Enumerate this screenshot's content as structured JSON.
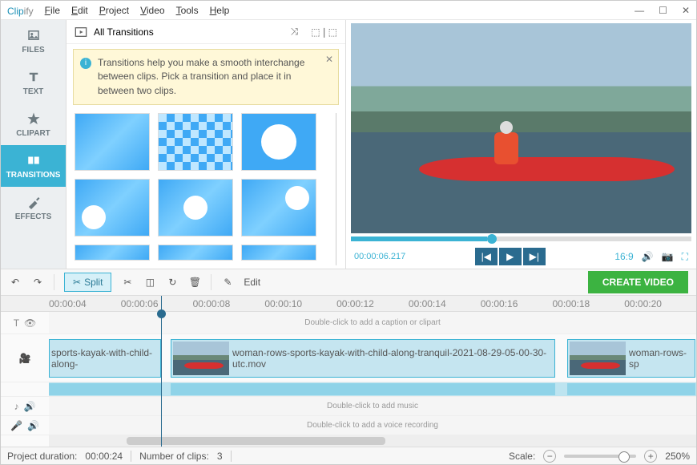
{
  "app": {
    "logo_main": "Clip",
    "logo_suffix": "ify"
  },
  "menu": {
    "file": "File",
    "edit": "Edit",
    "project": "Project",
    "video": "Video",
    "tools": "Tools",
    "help": "Help"
  },
  "sidebar": {
    "files": "FILES",
    "text": "TEXT",
    "clipart": "CLIPART",
    "transitions": "TRANSITIONS",
    "effects": "EFFECTS"
  },
  "center": {
    "title": "All Transitions",
    "info": "Transitions help you make a smooth interchange between clips. Pick a transition and place it in between two clips."
  },
  "preview": {
    "timecode": "00:00:06.217",
    "aspect": "16:9"
  },
  "toolbar": {
    "split": "Split",
    "edit": "Edit",
    "create": "CREATE VIDEO"
  },
  "ruler": {
    "t0": "00:00:04",
    "t1": "00:00:06",
    "t2": "00:00:08",
    "t3": "00:00:10",
    "t4": "00:00:12",
    "t5": "00:00:14",
    "t6": "00:00:16",
    "t7": "00:00:18",
    "t8": "00:00:20"
  },
  "tracks": {
    "caption": "Double-click to add a caption or clipart",
    "music": "Double-click to add music",
    "voice": "Double-click to add a voice recording",
    "clip1": "sports-kayak-with-child-along-",
    "clip2": "woman-rows-sports-kayak-with-child-along-tranquil-2021-08-29-05-00-30-utc.mov",
    "clip3": "woman-rows-sp"
  },
  "status": {
    "duration_lbl": "Project duration:",
    "duration": "00:00:24",
    "clips_lbl": "Number of clips:",
    "clips": "3",
    "scale_lbl": "Scale:",
    "scale": "250%"
  }
}
